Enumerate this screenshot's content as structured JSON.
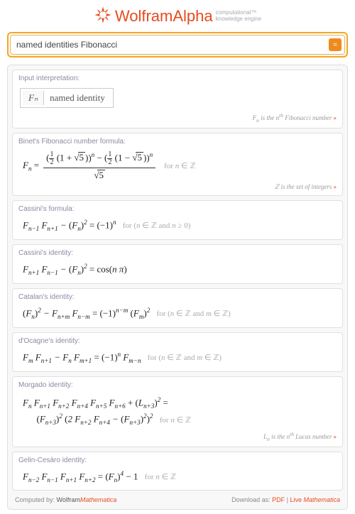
{
  "logo": {
    "main": "WolframAlpha",
    "sub1": "computational™",
    "sub2": "knowledge engine"
  },
  "search": {
    "value": "named identities Fibonacci"
  },
  "pod_input": {
    "title": "Input interpretation:",
    "fn": "Fₙ",
    "label": "named identity",
    "note_html": "<i>F<sub>n</sub></i> is the <i>n</i><sup>th</sup> Fibonacci number"
  },
  "pod_binet": {
    "title": "Binet's Fibonacci number formula:",
    "note_html": "ℤ is the set of integers"
  },
  "pod_cassini_f": {
    "title": "Cassini's formula:"
  },
  "pod_cassini_i": {
    "title": "Cassini's identity:"
  },
  "pod_catalan": {
    "title": "Catalan's identity:"
  },
  "pod_docagne": {
    "title": "d'Ocagne's identity:"
  },
  "pod_morgado": {
    "title": "Morgado identity:",
    "note_html": "<i>L<sub>n</sub></i> is the <i>n</i><sup>th</sup> Lucas number"
  },
  "pod_gelin": {
    "title": "Gelin-Cesàro identity:"
  },
  "footer": {
    "left_pre": "Computed by: ",
    "left_brand": "Wolfram",
    "left_em": "Mathematica",
    "right_pre": "Download as: ",
    "pdf": "PDF",
    "sep": " | ",
    "live": "Live ",
    "live_em": "Mathematica"
  },
  "chart_data": {
    "type": "table",
    "identities": [
      {
        "name": "Binet's Fibonacci number formula",
        "formula": "F_n = ((1/2(1+√5))^n − (1/2(1−√5))^n)/√5",
        "condition": "n ∈ ℤ"
      },
      {
        "name": "Cassini's formula",
        "formula": "F_{n−1} F_{n+1} − (F_n)^2 = (−1)^n",
        "condition": "n ∈ ℤ and n ≥ 0"
      },
      {
        "name": "Cassini's identity",
        "formula": "F_{n+1} F_{n−1} − (F_n)^2 = cos(nπ)",
        "condition": ""
      },
      {
        "name": "Catalan's identity",
        "formula": "(F_n)^2 − F_{n+m} F_{n−m} = (−1)^{n−m} (F_m)^2",
        "condition": "n ∈ ℤ and m ∈ ℤ"
      },
      {
        "name": "d'Ocagne's identity",
        "formula": "F_m F_{n+1} − F_n F_{m+1} = (−1)^n F_{m−n}",
        "condition": "n ∈ ℤ and m ∈ ℤ"
      },
      {
        "name": "Morgado identity",
        "formula": "F_n F_{n+1} F_{n+2} F_{n+4} F_{n+5} F_{n+6} + (L_{n+3})^2 = (F_{n+3})^2 (2 F_{n+2} F_{n+4} − (F_{n+3})^2)^2",
        "condition": "n ∈ ℤ"
      },
      {
        "name": "Gelin-Cesàro identity",
        "formula": "F_{n−2} F_{n−1} F_{n+1} F_{n+2} = (F_n)^4 − 1",
        "condition": "n ∈ ℤ"
      }
    ]
  }
}
